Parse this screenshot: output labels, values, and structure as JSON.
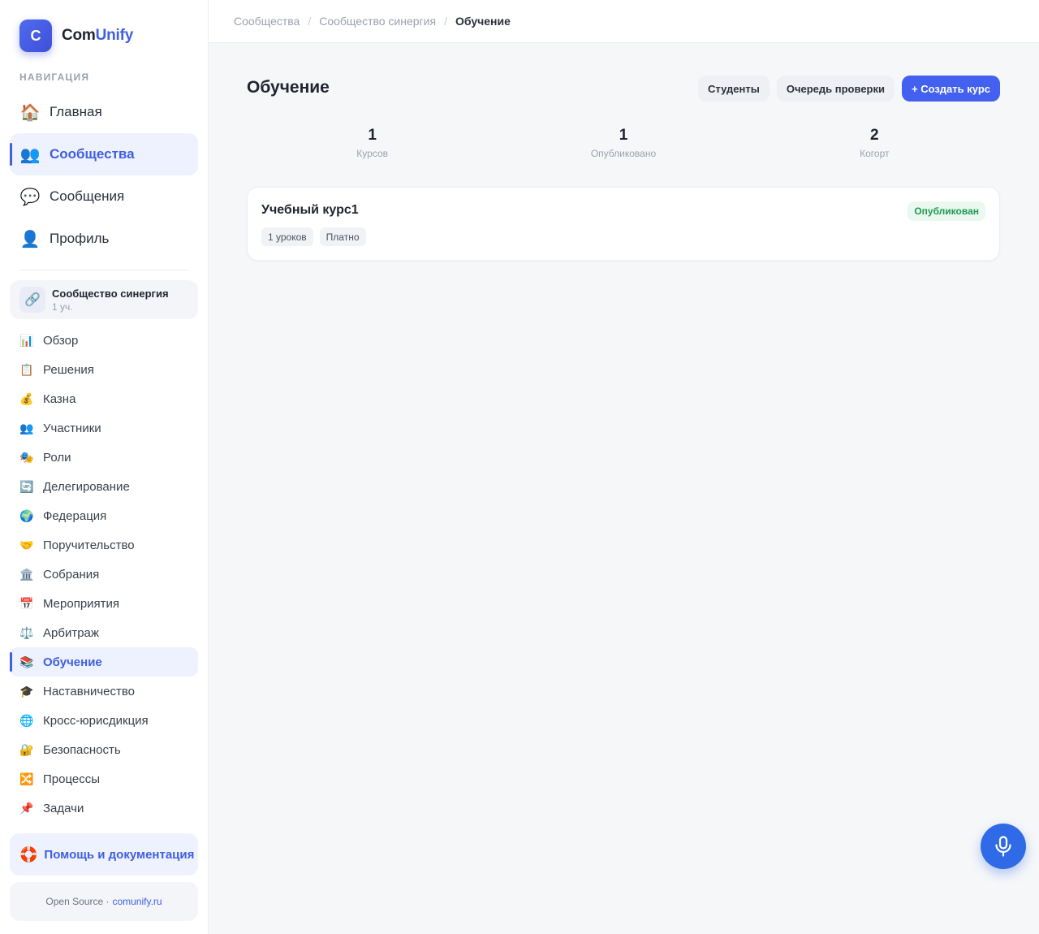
{
  "brand": {
    "letter": "C",
    "name_part1": "Com",
    "name_part2": "Unify"
  },
  "nav_caption": "НАВИГАЦИЯ",
  "main_nav": [
    {
      "icon": "🏠",
      "label": "Главная",
      "active": false
    },
    {
      "icon": "👥",
      "label": "Сообщества",
      "active": true
    },
    {
      "icon": "💬",
      "label": "Сообщения",
      "active": false
    },
    {
      "icon": "👤",
      "label": "Профиль",
      "active": false
    }
  ],
  "community": {
    "icon": "🔗",
    "name": "Сообщество синергия",
    "members": "1 уч."
  },
  "sub_nav": [
    {
      "icon": "📊",
      "label": "Обзор"
    },
    {
      "icon": "📋",
      "label": "Решения"
    },
    {
      "icon": "💰",
      "label": "Казна"
    },
    {
      "icon": "👥",
      "label": "Участники"
    },
    {
      "icon": "🎭",
      "label": "Роли"
    },
    {
      "icon": "🔄",
      "label": "Делегирование"
    },
    {
      "icon": "🌍",
      "label": "Федерация"
    },
    {
      "icon": "🤝",
      "label": "Поручительство"
    },
    {
      "icon": "🏛️",
      "label": "Собрания"
    },
    {
      "icon": "📅",
      "label": "Мероприятия"
    },
    {
      "icon": "⚖️",
      "label": "Арбитраж"
    },
    {
      "icon": "📚",
      "label": "Обучение"
    },
    {
      "icon": "🎓",
      "label": "Наставничество"
    },
    {
      "icon": "🌐",
      "label": "Кросс-юрисдикция"
    },
    {
      "icon": "🔐",
      "label": "Безопасность"
    },
    {
      "icon": "🔀",
      "label": "Процессы"
    },
    {
      "icon": "📌",
      "label": "Задачи"
    }
  ],
  "sub_nav_active_index": 11,
  "help": {
    "icon": "🛟",
    "label": "Помощь и документация"
  },
  "footer": {
    "text": "Open Source ·",
    "link": "comunify.ru"
  },
  "breadcrumb": [
    "Сообщества",
    "Сообщество синергия",
    "Обучение"
  ],
  "page": {
    "title": "Обучение",
    "buttons": {
      "students": "Студенты",
      "review_queue": "Очередь проверки",
      "create_course": "+ Создать курс"
    }
  },
  "stats": [
    {
      "value": "1",
      "label": "Курсов"
    },
    {
      "value": "1",
      "label": "Опубликовано"
    },
    {
      "value": "2",
      "label": "Когорт"
    }
  ],
  "courses": [
    {
      "title": "Учебный курс1",
      "status": "Опубликован",
      "tags": [
        "1 уроков",
        "Платно"
      ]
    }
  ],
  "colors": {
    "accent": "#3f5fe0",
    "primary_button": "#4361ee",
    "published_badge": "#1e9a52",
    "mic_button": "#2f6be6"
  }
}
